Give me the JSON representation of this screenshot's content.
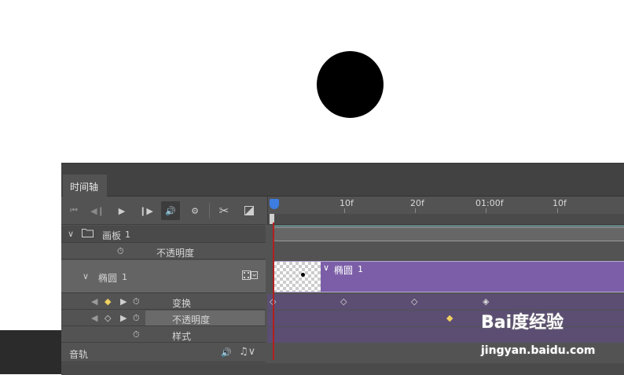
{
  "tabs": {
    "timeline": "时间轴"
  },
  "ruler": {
    "labels": [
      "10f",
      "20f",
      "01:00f",
      "10f"
    ]
  },
  "layers": {
    "artboard": {
      "name": "画板",
      "index": "1",
      "opacity_label": "不透明度"
    },
    "ellipse": {
      "name": "椭圆",
      "index": "1",
      "clip_name": "椭圆",
      "clip_index": "1",
      "props": {
        "transform": "变换",
        "opacity": "不透明度",
        "style": "样式"
      }
    },
    "audio": {
      "name": "音轨"
    }
  },
  "watermark": {
    "logo": "Bai度经验",
    "url": "jingyan.baidu.com"
  },
  "colors": {
    "clip": "#7b5ea7",
    "clip_dark": "#5b4e72",
    "playhead": "#3d7de0",
    "playhead_line": "#b31f1f",
    "keyframe_active": "#f0d060"
  },
  "icons": [
    "go-to-first-frame-icon",
    "previous-frame-icon",
    "play-icon",
    "next-frame-icon",
    "audio-icon",
    "settings-icon",
    "split-scissors-icon",
    "transition-icon",
    "stopwatch-icon",
    "folder-icon",
    "film-icon",
    "music-note-icon"
  ]
}
